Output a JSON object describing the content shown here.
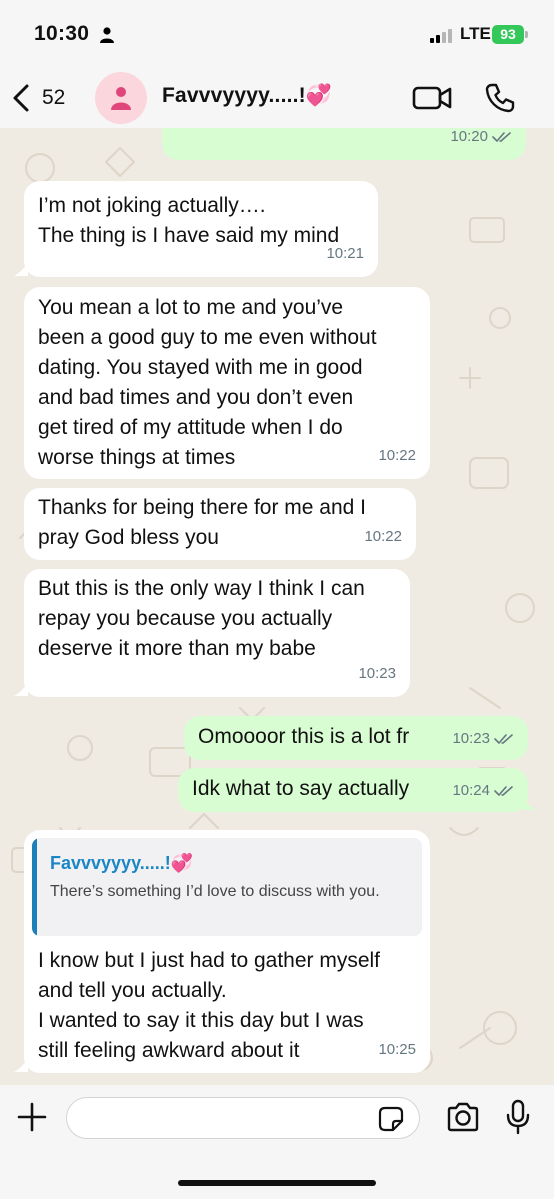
{
  "status_bar": {
    "time": "10:30",
    "network": "LTE",
    "battery": "93"
  },
  "header": {
    "back_count": "52",
    "contact_name": "Favvvyyyy.....!💞"
  },
  "messages": [
    {
      "direction": "out",
      "text": "",
      "time": "10:20"
    },
    {
      "direction": "in",
      "text": "I’m not joking actually….\nThe thing is I have said my mind",
      "time": "10:21"
    },
    {
      "direction": "in",
      "text": "You mean a lot to me and you’ve\nbeen a good guy to me even without\ndating. You stayed with me in good\nand bad times and you don’t even\nget tired of my attitude when I do\nworse things at times",
      "time": "10:22"
    },
    {
      "direction": "in",
      "text": "Thanks for being there for me and I\npray God bless you",
      "time": "10:22"
    },
    {
      "direction": "in",
      "text": "But this is the only way I think I can\nrepay you because you actually\ndeserve it more than my babe",
      "time": "10:23"
    },
    {
      "direction": "out",
      "text": "Omoooor this is a lot fr",
      "time": "10:23"
    },
    {
      "direction": "out",
      "text": "Idk what to say actually",
      "time": "10:24"
    },
    {
      "direction": "in",
      "reply_to": {
        "name": "Favvvyyyy.....!💞",
        "text": "There’s something I’d love to discuss with you."
      },
      "text": "I know but I just had to gather myself\nand tell you actually.\nI wanted to say it this day but I was\nstill feeling awkward about it",
      "time": "10:25"
    }
  ],
  "input": {
    "value": "",
    "placeholder": ""
  },
  "icons": {
    "person": "person-icon",
    "back": "chevron-left-icon",
    "avatar": "person-icon",
    "video": "video-call-icon",
    "call": "phone-icon",
    "plus": "plus-icon",
    "sticker": "sticker-icon",
    "camera": "camera-icon",
    "mic": "microphone-icon",
    "read": "double-check-icon"
  },
  "colors": {
    "incoming_bubble": "#ffffff",
    "outgoing_bubble": "#d9fdd3",
    "chat_background": "#efeae2",
    "battery": "#34c759",
    "avatar_bg": "#fbd6dd",
    "avatar_fg": "#e0457b",
    "reply_accent": "#1b86c4",
    "read_ticks": "#667781"
  }
}
